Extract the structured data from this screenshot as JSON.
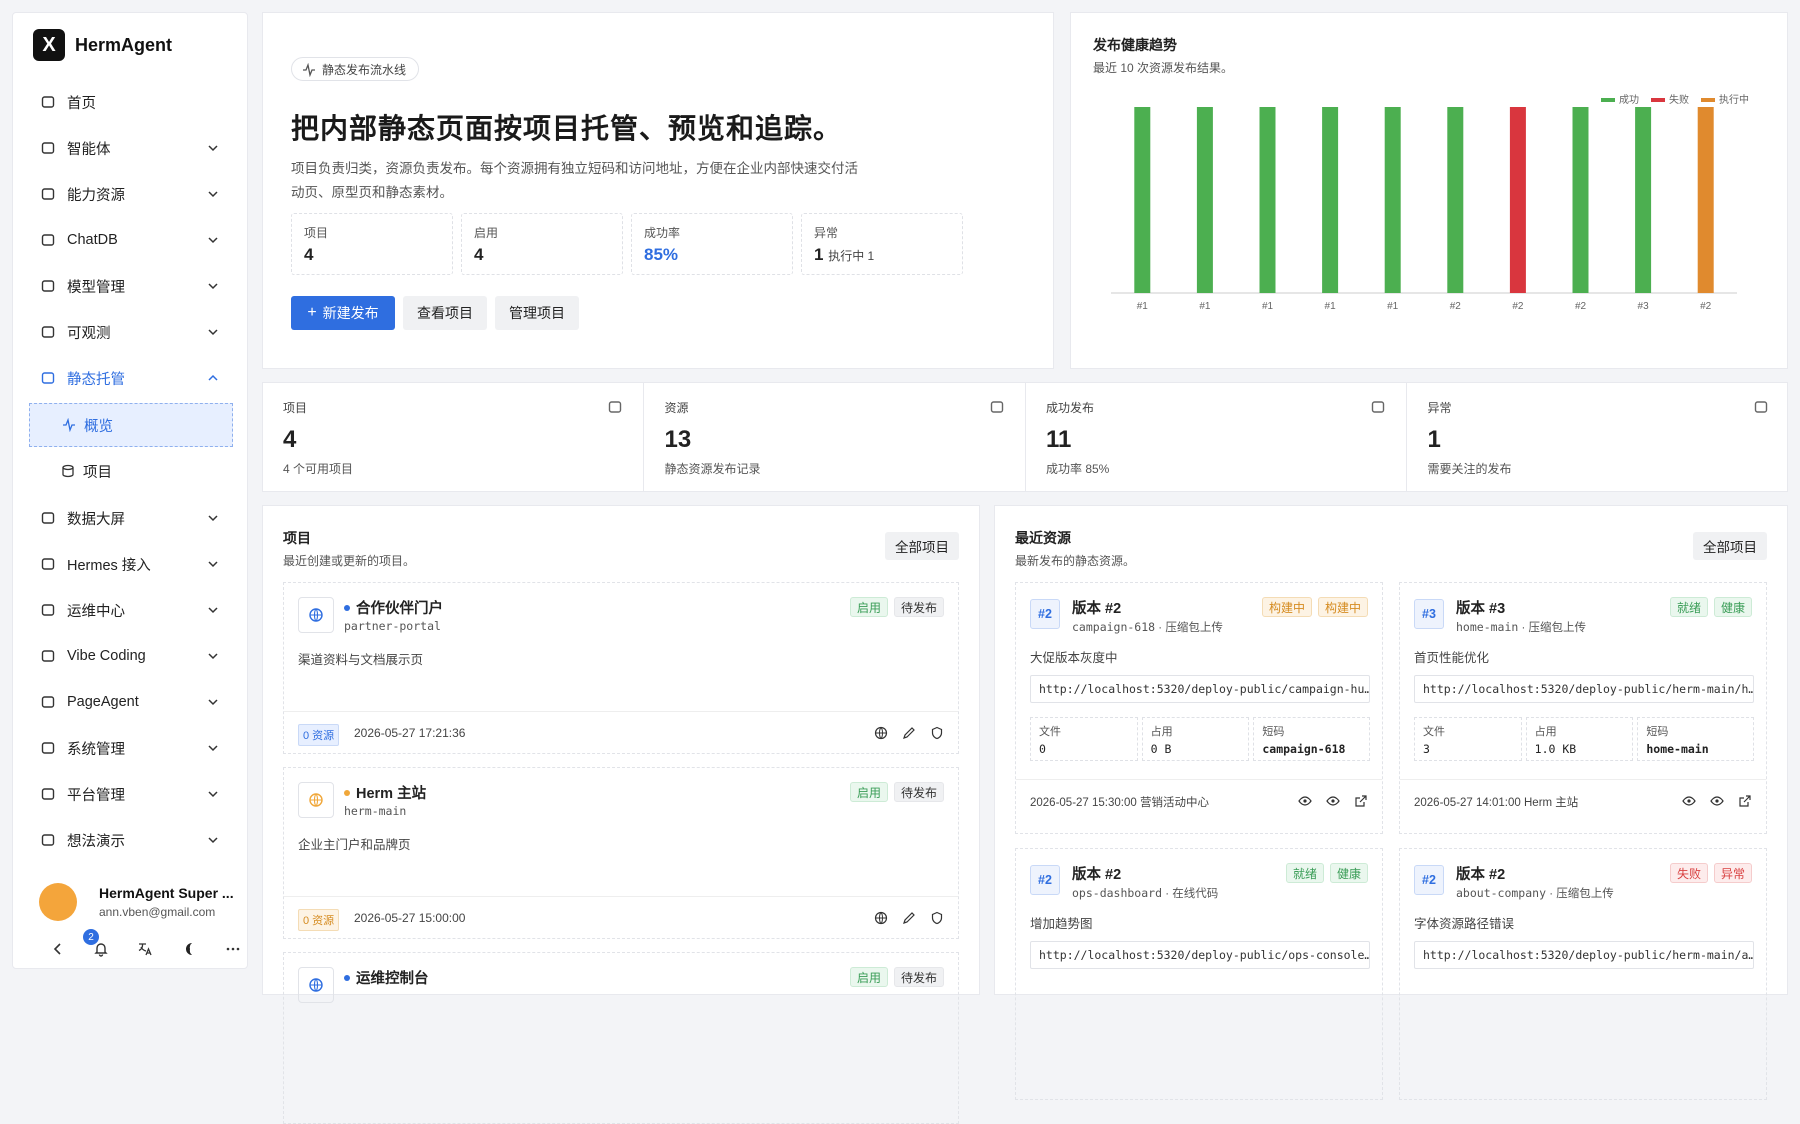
{
  "brand": {
    "logo": "X",
    "name": "HermAgent"
  },
  "nav": [
    {
      "label": "首页",
      "icon": "home-icon",
      "chevron": false
    },
    {
      "label": "智能体",
      "icon": "robot-icon",
      "chevron": true
    },
    {
      "label": "能力资源",
      "icon": "network-icon",
      "chevron": true
    },
    {
      "label": "ChatDB",
      "icon": "database-icon",
      "chevron": true
    },
    {
      "label": "模型管理",
      "icon": "sliders-icon",
      "chevron": true
    },
    {
      "label": "可观测",
      "icon": "activity-icon",
      "chevron": true
    },
    {
      "label": "静态托管",
      "icon": "cloud-icon",
      "chevron": true,
      "active": true
    }
  ],
  "nav_sub": [
    {
      "label": "概览",
      "selected": true
    },
    {
      "label": "项目"
    }
  ],
  "nav2": [
    {
      "label": "数据大屏",
      "icon": "layers-icon"
    },
    {
      "label": "Hermes 接入",
      "icon": "wrench-icon"
    },
    {
      "label": "运维中心",
      "icon": "terminal-icon"
    },
    {
      "label": "Vibe Coding",
      "icon": "code-icon"
    },
    {
      "label": "PageAgent",
      "icon": "agent-icon"
    },
    {
      "label": "系统管理",
      "icon": "toggle-icon"
    },
    {
      "label": "平台管理",
      "icon": "sliders-icon"
    },
    {
      "label": "想法演示",
      "icon": "device-icon"
    }
  ],
  "user": {
    "name": "HermAgent Super ...",
    "email": "ann.vben@gmail.com",
    "notifications": "2"
  },
  "hero": {
    "chip": "静态发布流水线",
    "title": "把内部静态页面按项目托管、预览和追踪。",
    "desc": "项目负责归类，资源负责发布。每个资源拥有独立短码和访问地址，方便在企业内部快速交付活动页、原型页和静态素材。",
    "stats": [
      {
        "label": "项目",
        "value": "4",
        "extra": ""
      },
      {
        "label": "启用",
        "value": "4",
        "extra": ""
      },
      {
        "label": "成功率",
        "value": "85%",
        "extra": ""
      },
      {
        "label": "异常",
        "value": "1",
        "extra": "执行中 1"
      }
    ],
    "buttons": {
      "new": "新建发布",
      "view": "查看项目",
      "manage": "管理项目"
    }
  },
  "chart": {
    "title": "发布健康趋势",
    "subtitle": "最近 10 次资源发布结果。",
    "colors": {
      "成功": "#4caf50",
      "失败": "#d9363e",
      "执行中": "#e08a2e"
    }
  },
  "chart_data": {
    "type": "bar",
    "categories": [
      "#1",
      "#1",
      "#1",
      "#1",
      "#1",
      "#2",
      "#2",
      "#2",
      "#3",
      "#2"
    ],
    "values": [
      1,
      1,
      1,
      1,
      1,
      1,
      1,
      1,
      1,
      1
    ],
    "status": [
      "成功",
      "成功",
      "成功",
      "成功",
      "成功",
      "成功",
      "失败",
      "成功",
      "成功",
      "执行中"
    ],
    "legend": [
      "成功",
      "失败",
      "执行中"
    ],
    "legend_position": "top-right",
    "ylim": [
      0,
      1
    ],
    "grid": false
  },
  "stats": [
    {
      "label": "项目",
      "value": "4",
      "sub": "4 个可用项目",
      "icon": "server-icon"
    },
    {
      "label": "资源",
      "value": "13",
      "sub": "静态资源发布记录",
      "icon": "database-icon"
    },
    {
      "label": "成功发布",
      "value": "11",
      "sub": "成功率 85%",
      "icon": "check-circle-icon"
    },
    {
      "label": "异常",
      "value": "1",
      "sub": "需要关注的发布",
      "icon": "alert-icon"
    }
  ],
  "projects": {
    "title": "项目",
    "subtitle": "最近创建或更新的项目。",
    "all": "全部项目",
    "items": [
      {
        "name": "合作伙伴门户",
        "slug": "partner-portal",
        "desc": "渠道资料与文档展示页",
        "tags": [
          "启用",
          "待发布"
        ],
        "res": "0 资源",
        "date": "2026-05-27 17:21:36",
        "accent": "#2f6ee0"
      },
      {
        "name": "Herm 主站",
        "slug": "herm-main",
        "desc": "企业主门户和品牌页",
        "tags": [
          "启用",
          "待发布"
        ],
        "res": "0 资源",
        "date": "2026-05-27 15:00:00",
        "accent": "#f0a73a"
      },
      {
        "name": "运维控制台",
        "slug": "",
        "desc": "",
        "tags": [
          "启用",
          "待发布"
        ],
        "res": "",
        "date": "",
        "accent": "#2f6ee0"
      }
    ]
  },
  "resources": {
    "title": "最近资源",
    "subtitle": "最新发布的静态资源。",
    "all": "全部项目",
    "labels": {
      "files": "文件",
      "size": "占用",
      "code": "短码"
    },
    "items": [
      {
        "num": "#2",
        "name": "版本 #2",
        "slug": "campaign-618",
        "mode": "压缩包上传",
        "tags": [
          [
            "构建中",
            "orange"
          ],
          [
            "构建中",
            "orange"
          ]
        ],
        "desc": "大促版本灰度中",
        "url": "http://localhost:5320/deploy-public/campaign-hu…",
        "files": "0",
        "size": "0 B",
        "code": "campaign-618",
        "date": "2026-05-27 15:30:00",
        "project": "营销活动中心"
      },
      {
        "num": "#3",
        "name": "版本 #3",
        "slug": "home-main",
        "mode": "压缩包上传",
        "tags": [
          [
            "就绪",
            "green"
          ],
          [
            "健康",
            "green"
          ]
        ],
        "desc": "首页性能优化",
        "url": "http://localhost:5320/deploy-public/herm-main/h…",
        "files": "3",
        "size": "1.0 KB",
        "code": "home-main",
        "date": "2026-05-27 14:01:00",
        "project": "Herm 主站"
      },
      {
        "num": "#2",
        "name": "版本 #2",
        "slug": "ops-dashboard",
        "mode": "在线代码",
        "tags": [
          [
            "就绪",
            "green"
          ],
          [
            "健康",
            "green"
          ]
        ],
        "desc": "增加趋势图",
        "url": "http://localhost:5320/deploy-public/ops-console…",
        "files": "",
        "size": "",
        "code": "",
        "date": "",
        "project": ""
      },
      {
        "num": "#2",
        "name": "版本 #2",
        "slug": "about-company",
        "mode": "压缩包上传",
        "tags": [
          [
            "失败",
            "red"
          ],
          [
            "异常",
            "red"
          ]
        ],
        "desc": "字体资源路径错误",
        "url": "http://localhost:5320/deploy-public/herm-main/a…",
        "files": "",
        "size": "",
        "code": "",
        "date": "",
        "project": ""
      }
    ]
  }
}
